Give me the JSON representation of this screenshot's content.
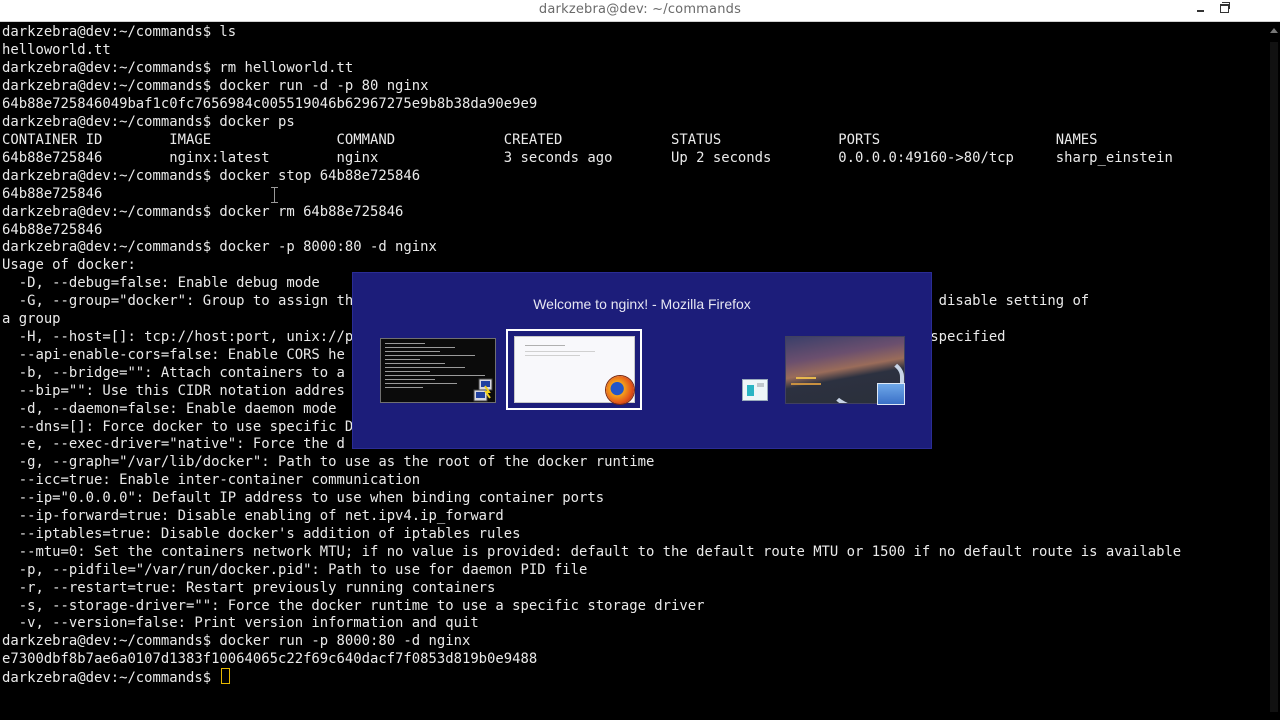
{
  "window": {
    "title": "darkzebra@dev: ~/commands",
    "minimize_label": "Minimize",
    "restore_label": "Restore"
  },
  "terminal": {
    "lines": [
      "darkzebra@dev:~/commands$ ls",
      "helloworld.tt",
      "darkzebra@dev:~/commands$ rm helloworld.tt",
      "darkzebra@dev:~/commands$ docker run -d -p 80 nginx",
      "64b88e725846049baf1c0fc7656984c005519046b62967275e9b8b38da90e9e9",
      "darkzebra@dev:~/commands$ docker ps",
      "CONTAINER ID        IMAGE               COMMAND             CREATED             STATUS              PORTS                     NAMES",
      "64b88e725846        nginx:latest        nginx               3 seconds ago       Up 2 seconds        0.0.0.0:49160->80/tcp     sharp_einstein",
      "darkzebra@dev:~/commands$ docker stop 64b88e725846",
      "64b88e725846",
      "darkzebra@dev:~/commands$ docker rm 64b88e725846",
      "64b88e725846",
      "darkzebra@dev:~/commands$ docker -p 8000:80 -d nginx",
      "Usage of docker:",
      "  -D, --debug=false: Enable debug mode",
      "  -G, --group=\"docker\": Group to assign th                                                  he empty string) to disable setting of",
      "a group",
      "  -H, --host=[]: tcp://host:port, unix://p                                                   le sockets can be specified",
      "  --api-enable-cors=false: Enable CORS he",
      "  -b, --bridge=\"\": Attach containers to a                                                   king",
      "  --bip=\"\": Use this CIDR notation addres",
      "  -d, --daemon=false: Enable daemon mode",
      "  --dns=[]: Force docker to use specific D",
      "  -e, --exec-driver=\"native\": Force the d",
      "  -g, --graph=\"/var/lib/docker\": Path to use as the root of the docker runtime",
      "  --icc=true: Enable inter-container communication",
      "  --ip=\"0.0.0.0\": Default IP address to use when binding container ports",
      "  --ip-forward=true: Disable enabling of net.ipv4.ip_forward",
      "  --iptables=true: Disable docker's addition of iptables rules",
      "  --mtu=0: Set the containers network MTU; if no value is provided: default to the default route MTU or 1500 if no default route is available",
      "  -p, --pidfile=\"/var/run/docker.pid\": Path to use for daemon PID file",
      "  -r, --restart=true: Restart previously running containers",
      "  -s, --storage-driver=\"\": Force the docker runtime to use a specific storage driver",
      "  -v, --version=false: Print version information and quit",
      "darkzebra@dev:~/commands$ docker run -p 8000:80 -d nginx",
      "e7300dbf8b7ae6a0107d1383f10064065c22f69c640dacf7f0853d819b0e9488",
      "darkzebra@dev:~/commands$ "
    ]
  },
  "switcher": {
    "title": "Welcome to nginx! - Mozilla Firefox",
    "windows": [
      {
        "name": "terminal",
        "icon": "putty-icon",
        "selected": false
      },
      {
        "name": "firefox",
        "icon": "firefox-icon",
        "selected": true
      },
      {
        "name": "app",
        "icon": "app-icon",
        "selected": false
      },
      {
        "name": "photos",
        "icon": "photo-viewer-icon",
        "selected": false
      }
    ]
  },
  "colors": {
    "terminal_bg": "#000000",
    "terminal_fg": "#eaeaea",
    "cursor": "#e6b800",
    "switcher_bg": "#1c1d7a"
  }
}
